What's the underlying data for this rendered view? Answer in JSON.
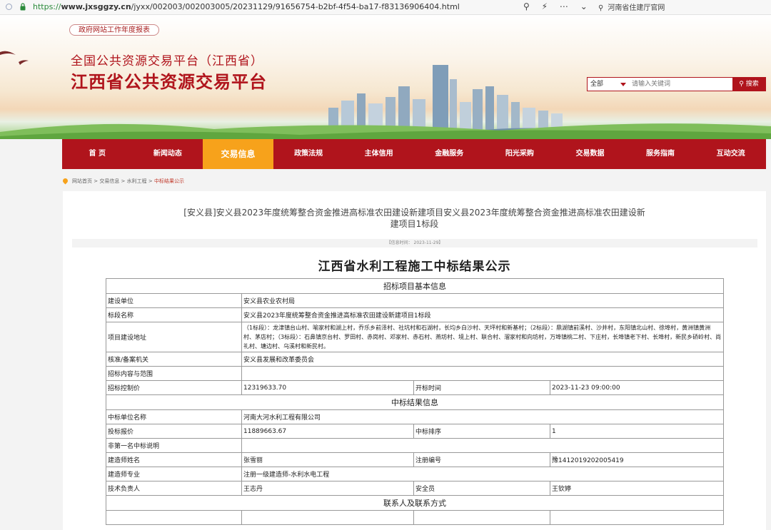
{
  "browser": {
    "url_scheme": "https://",
    "url_host": "www.jxsggzy.cn",
    "url_path": "/jyxx/002003/002003005/20231129/91656754-b2bf-4f54-ba17-f83136906404.html",
    "search_text": "河南省住建厅官网",
    "tools": [
      "zoom-icon",
      "bolt-icon",
      "more-icon",
      "chevron-down-icon"
    ]
  },
  "header": {
    "report_link": "政府网站工作年度报表",
    "logo_sub": "全国公共资源交易平台（江西省）",
    "logo_main": "江西省公共资源交易平台",
    "search_scope": "全部",
    "search_placeholder": "请输入关键词",
    "search_button": "搜索"
  },
  "nav": [
    "首 页",
    "新闻动态",
    "交易信息",
    "政策法规",
    "主体信用",
    "金融服务",
    "阳光采购",
    "交易数据",
    "服务指南",
    "互动交流"
  ],
  "breadcrumb": {
    "path": "网站首页 > 交易信息 > 水利工程 > ",
    "current": "中标结果公示"
  },
  "article": {
    "title_line1": "[安义县]安义县2023年度统筹整合资金推进高标准农田建设新建项目安义县2023年度统筹整合资金推进高标准农田建设新",
    "title_line2": "建项目1标段",
    "info": "【信息时间：  2023-11-29】",
    "doc_title": "江西省水利工程施工中标结果公示"
  },
  "table": {
    "section_basic": "招标项目基本信息",
    "build_unit_label": "建设单位",
    "build_unit": "安义县农业农村局",
    "section_name_label": "标段名称",
    "section_name": "安义县2023年度统筹整合资金推进高标准农田建设新建项目1标段",
    "address_label": "项目建设地址",
    "address": "（1标段）：龙津镇台山村、喻家村和湖上村，乔乐乡前泽村、社坑村和石湖村，长均乡白沙村、天坪村和新基村；（2标段）：鼎湖镇前溪村、沙井村，东阳镇北山村、徐埠村，黄洲镇黄洲村、茅店村；（3标段）：石鼻镇京台村、罗田村、赤岗村、邓家村、赤石村、燕坊村、境上村、联合村、溜家村和向坊村，万埠镇桃二村、下庄村，长埠镇老下村、长埠村，新民乡硚岭村、尚礼村、塘边村、乌溪村和新民村。",
    "approval_label": "核准/备案机关",
    "approval": "安义县发展和改革委员会",
    "scope_label": "招标内容与范围",
    "scope": "",
    "control_price_label": "招标控制价",
    "control_price": "12319633.70",
    "open_time_label": "开标时间",
    "open_time": "2023-11-23 09:00:00",
    "section_result": "中标结果信息",
    "winner_label": "中标单位名称",
    "winner": "河南大河水利工程有限公司",
    "bid_price_label": "投标报价",
    "bid_price": "11889663.67",
    "rank_label": "中标排序",
    "rank": "1",
    "non_first_label": "非第一名中标说明",
    "non_first": "",
    "builder_name_label": "建造师姓名",
    "builder_name": "张雪丽",
    "reg_no_label": "注册编号",
    "reg_no": "豫1412019202005419",
    "builder_major_label": "建造师专业",
    "builder_major": "注册一级建造师-水利水电工程",
    "tech_lead_label": "技术负责人",
    "tech_lead": "王志丹",
    "safety_label": "安全员",
    "safety": "王钦婷",
    "section_contact": "联系人及联系方式"
  }
}
